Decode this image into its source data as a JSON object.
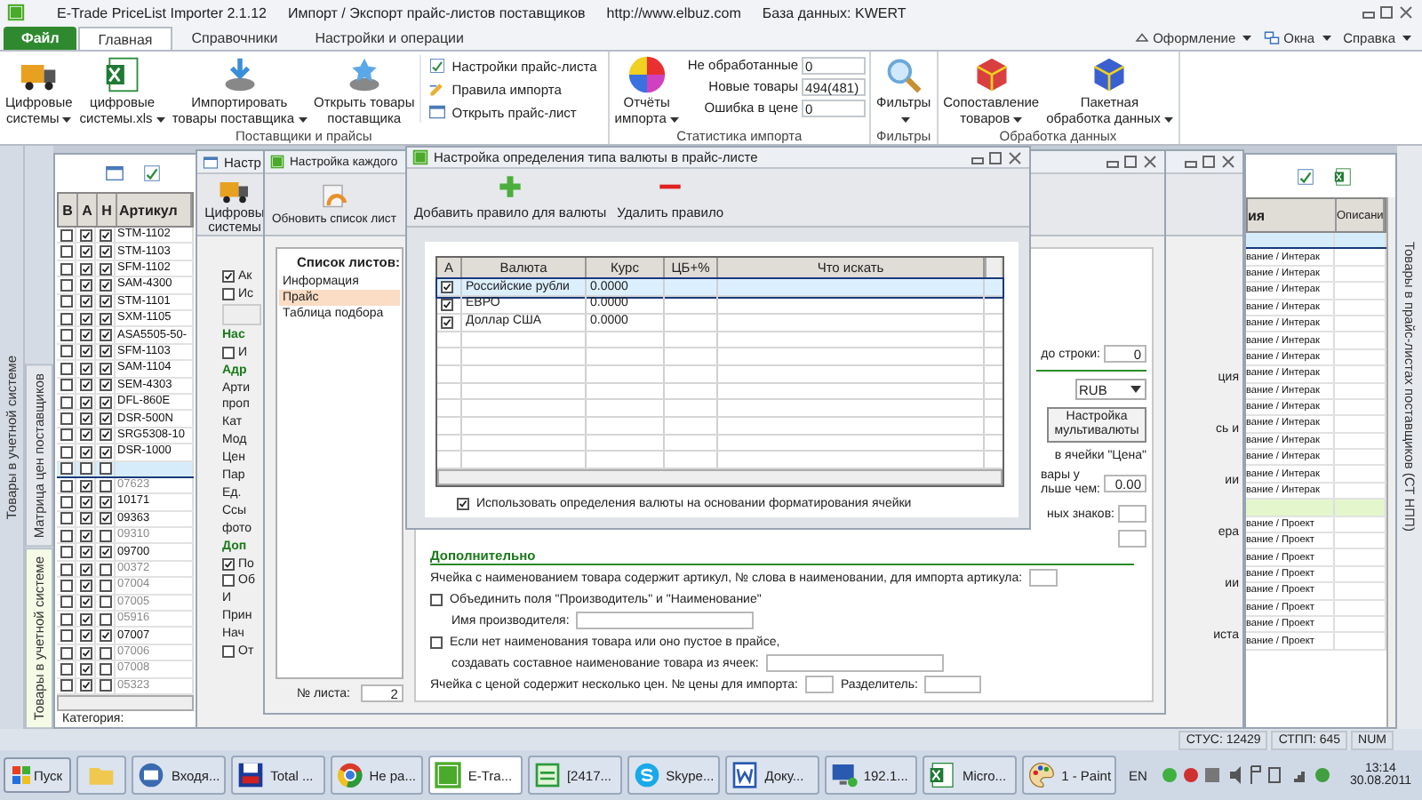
{
  "title_bar": {
    "title": "E-Trade PriceList Importer 2.1.12",
    "subtitle": "Импорт / Экспорт прайс-листов поставщиков",
    "url": "http://www.elbuz.com",
    "database": "База данных: KWERT"
  },
  "ribbon": {
    "file_tab": "Файл",
    "tabs": [
      {
        "label": "Главная",
        "selected": true
      },
      {
        "label": "Справочники",
        "selected": false
      },
      {
        "label": "Настройки и операции",
        "selected": false
      }
    ],
    "menus": [
      {
        "label": "Оформление"
      },
      {
        "label": "Окна"
      },
      {
        "label": "Справка"
      }
    ],
    "groups": [
      {
        "label": "Поставщики и прайсы",
        "items": [
          {
            "kind": "large",
            "lines": [
              "Цифровые",
              "системы"
            ],
            "dropdown": true
          },
          {
            "kind": "large",
            "lines": [
              "цифровые",
              "системы.xls"
            ],
            "dropdown": true
          },
          {
            "kind": "large",
            "lines": [
              "Импортировать",
              "товары поставщика"
            ],
            "dropdown": true
          },
          {
            "kind": "large",
            "lines": [
              "Открыть товары",
              "поставщика"
            ],
            "dropdown": false
          },
          {
            "kind": "list",
            "entries": [
              {
                "label": "Настройки прайс-листа"
              },
              {
                "label": "Правила импорта"
              },
              {
                "label": "Открыть прайс-лист"
              }
            ]
          }
        ]
      },
      {
        "label": "Статистика импорта",
        "items": [
          {
            "kind": "large",
            "lines": [
              "Отчёты",
              "импорта"
            ],
            "dropdown": true
          },
          {
            "kind": "stats",
            "entries": [
              {
                "label": "Не обработанные",
                "value": "0"
              },
              {
                "label": "Новые товары",
                "value": "494(481)"
              },
              {
                "label": "Ошибка в цене",
                "value": "0"
              }
            ]
          }
        ]
      },
      {
        "label": "Фильтры",
        "items": [
          {
            "kind": "large",
            "lines": [
              "Фильтры"
            ],
            "dropdown": true
          }
        ]
      },
      {
        "label": "Обработка данных",
        "items": [
          {
            "kind": "large",
            "lines": [
              "Сопоставление",
              "товаров"
            ],
            "dropdown": true
          },
          {
            "kind": "large",
            "lines": [
              "Пакетная",
              "обработка данных"
            ],
            "dropdown": true
          }
        ]
      }
    ]
  },
  "left_tabs": [
    {
      "label": "Товары в учетной системе",
      "selected": false
    }
  ],
  "inner_tabs": [
    {
      "label": "Матрица цен поставщиков",
      "selected": false
    },
    {
      "label": "Товары в учетной системе",
      "selected": true
    }
  ],
  "right_tab": {
    "label": "Товары в прайс-листах поставщиков (СТ НПП)"
  },
  "products_grid": {
    "columns": [
      "В",
      "А",
      "Н",
      "Артикул"
    ],
    "footer": "Категория:",
    "rows": [
      {
        "b": false,
        "a": true,
        "n": true,
        "article": "STM-1102",
        "selected": false
      },
      {
        "b": false,
        "a": true,
        "n": true,
        "article": "STM-1103",
        "selected": false
      },
      {
        "b": false,
        "a": true,
        "n": true,
        "article": "SFM-1102",
        "selected": false
      },
      {
        "b": false,
        "a": true,
        "n": true,
        "article": "SAM-4300",
        "selected": false
      },
      {
        "b": false,
        "a": true,
        "n": true,
        "article": "STM-1101",
        "selected": false
      },
      {
        "b": false,
        "a": true,
        "n": true,
        "article": "SXM-1105",
        "selected": false
      },
      {
        "b": false,
        "a": true,
        "n": true,
        "article": "ASA5505-50-",
        "selected": false
      },
      {
        "b": false,
        "a": true,
        "n": true,
        "article": "SFM-1103",
        "selected": false
      },
      {
        "b": false,
        "a": true,
        "n": true,
        "article": "SAM-1104",
        "selected": false
      },
      {
        "b": false,
        "a": true,
        "n": true,
        "article": "SEM-4303",
        "selected": false
      },
      {
        "b": false,
        "a": true,
        "n": true,
        "article": "DFL-860E",
        "selected": false
      },
      {
        "b": false,
        "a": true,
        "n": true,
        "article": "DSR-500N",
        "selected": false
      },
      {
        "b": false,
        "a": true,
        "n": true,
        "article": "SRG5308-10",
        "selected": false
      },
      {
        "b": false,
        "a": true,
        "n": true,
        "article": "DSR-1000",
        "selected": false
      },
      {
        "b": false,
        "a": false,
        "n": false,
        "selected": true
      },
      {
        "b": false,
        "a": true,
        "n": false,
        "article": "07623",
        "selected": false
      },
      {
        "b": false,
        "a": true,
        "n": true,
        "article": "10171",
        "selected": false
      },
      {
        "b": false,
        "a": true,
        "n": true,
        "article": "09363",
        "selected": false
      },
      {
        "b": false,
        "a": true,
        "n": false,
        "article": "09310",
        "selected": false
      },
      {
        "b": false,
        "a": true,
        "n": true,
        "article": "09700",
        "selected": false
      },
      {
        "b": false,
        "a": true,
        "n": false,
        "article": "00372",
        "selected": false
      },
      {
        "b": false,
        "a": true,
        "n": false,
        "article": "07004",
        "selected": false
      },
      {
        "b": false,
        "a": true,
        "n": false,
        "article": "07005",
        "selected": false
      },
      {
        "b": false,
        "a": true,
        "n": false,
        "article": "05916",
        "selected": false
      },
      {
        "b": false,
        "a": true,
        "n": true,
        "article": "07007",
        "selected": false
      },
      {
        "b": false,
        "a": true,
        "n": false,
        "article": "07006",
        "selected": false
      },
      {
        "b": false,
        "a": true,
        "n": false,
        "article": "07008",
        "selected": false
      },
      {
        "b": false,
        "a": true,
        "n": false,
        "article": "05323",
        "selected": false
      }
    ]
  },
  "price_grid": {
    "columns": [
      "ия",
      "Описани"
    ],
    "rows": [
      {
        "kind": "blank",
        "selected": true
      },
      {
        "kind": "item",
        "text": "вание / Интерак",
        "selected": false
      },
      {
        "kind": "item",
        "text": "вание / Интерак",
        "selected": false
      },
      {
        "kind": "item",
        "text": "вание / Интерак",
        "selected": false
      },
      {
        "kind": "item",
        "text": "вание / Интерак",
        "selected": false
      },
      {
        "kind": "item",
        "text": "вание / Интерак",
        "selected": false
      },
      {
        "kind": "item",
        "text": "вание / Интерак",
        "selected": false
      },
      {
        "kind": "item",
        "text": "вание / Интерак",
        "selected": false
      },
      {
        "kind": "item",
        "text": "вание / Интерак",
        "selected": false
      },
      {
        "kind": "item",
        "text": "вание / Интерак",
        "selected": false
      },
      {
        "kind": "item",
        "text": "вание / Интерак",
        "selected": false
      },
      {
        "kind": "item",
        "text": "вание / Интерак",
        "selected": false
      },
      {
        "kind": "item",
        "text": "вание / Интерак",
        "selected": false
      },
      {
        "kind": "item",
        "text": "вание / Интерак",
        "selected": false
      },
      {
        "kind": "item",
        "text": "вание / Интерак",
        "selected": false
      },
      {
        "kind": "item",
        "text": "вание / Интерак",
        "selected": false
      },
      {
        "kind": "group",
        "selected": false
      },
      {
        "kind": "item",
        "text": "вание / Проект",
        "selected": false
      },
      {
        "kind": "item",
        "text": "вание / Проект",
        "selected": false
      },
      {
        "kind": "item",
        "text": "вание / Проект",
        "selected": false
      },
      {
        "kind": "item",
        "text": "вание / Проект",
        "selected": false
      },
      {
        "kind": "item",
        "text": "вание / Проект",
        "selected": false
      },
      {
        "kind": "item",
        "text": "вание / Проект",
        "selected": false
      },
      {
        "kind": "item",
        "text": "вание / Проект",
        "selected": false
      },
      {
        "kind": "item",
        "text": "вание / Проект",
        "selected": false
      }
    ]
  },
  "supplier_window": {
    "title": "Настр",
    "tool": "Цифровы системы",
    "fragments": [
      {
        "kind": "checkbox",
        "label": "Ак",
        "checked": true
      },
      {
        "kind": "checkbox",
        "label": "Ис",
        "checked": false
      },
      {
        "kind": "field"
      },
      {
        "kind": "heading",
        "label": "Нас"
      },
      {
        "kind": "checkbox",
        "label": "И",
        "checked": false
      },
      {
        "kind": "heading",
        "label": "Адр"
      },
      {
        "kind": "label",
        "label": "Арти"
      },
      {
        "kind": "label",
        "label": "проп"
      },
      {
        "kind": "label",
        "label": "Кат"
      },
      {
        "kind": "label",
        "label": "Мод"
      },
      {
        "kind": "label",
        "label": "Цен"
      },
      {
        "kind": "label",
        "label": "Пар"
      },
      {
        "kind": "label",
        "label": "Ед."
      },
      {
        "kind": "label",
        "label": "Ссы"
      },
      {
        "kind": "label",
        "label": "фото"
      },
      {
        "kind": "heading",
        "label": "Доп"
      },
      {
        "kind": "checkbox",
        "label": "По",
        "checked": true
      },
      {
        "kind": "checkbox",
        "label": "Об",
        "checked": false
      },
      {
        "kind": "label",
        "label": "И"
      },
      {
        "kind": "label",
        "label": "Прин"
      },
      {
        "kind": "label",
        "label": "Нач"
      },
      {
        "kind": "checkbox",
        "label": "От",
        "checked": false
      }
    ],
    "side_fragments": [
      "ция",
      "сь и",
      "ии",
      "ера",
      "ии",
      "иста"
    ]
  },
  "sheet_window": {
    "title": "Настройка каждого",
    "tool": "Обновить список лист",
    "list_label": "Список листов:",
    "sheets": [
      {
        "label": "Информация",
        "selected": false
      },
      {
        "label": "Прайс",
        "selected": true
      },
      {
        "label": "Таблица подбора",
        "selected": false
      }
    ],
    "sheet_number_label": "№ листа:",
    "sheet_number": "2",
    "to_row_label": "до строки:",
    "to_row": "0",
    "currency": "RUB",
    "multi_button": "Настройка мультивалюты",
    "price_cell": "в ячейки \"Цена\"",
    "more_lines": [
      "вары у",
      "льше чем:"
    ],
    "more_value": "0.00",
    "digits_label": "ных знаков:",
    "extra_heading": "Дополнительно",
    "extra_rows": [
      {
        "kind": "field",
        "label": "Ячейка с наименованием товара содержит артикул, № слова в наименовании, для импорта артикула:"
      },
      {
        "kind": "checkbox",
        "label": "Объединить поля \"Производитель\" и \"Наименование\"",
        "checked": false
      },
      {
        "kind": "wide-field",
        "label": "Имя производителя:"
      },
      {
        "kind": "checkbox",
        "label": "Если нет наименования товара или оно пустое в прайсе,",
        "checked": false
      },
      {
        "kind": "wide-field",
        "label": "создавать составное наименование товара из ячеек:"
      },
      {
        "kind": "pair",
        "label": "Ячейка с ценой содержит несколько цен. № цены для импорта:",
        "label2": "Разделитель:"
      }
    ]
  },
  "currency_window": {
    "title": "Настройка определения типа валюты в прайс-листе",
    "tools": [
      {
        "label": "Добавить правило для валюты"
      },
      {
        "label": "Удалить правило"
      }
    ],
    "columns": [
      "А",
      "Валюта",
      "Курс",
      "ЦБ+%",
      "Что искать"
    ],
    "rows": [
      {
        "active": true,
        "currency": "Российские рубли",
        "rate": "0.0000",
        "selected": true
      },
      {
        "active": true,
        "currency": "ЕВРО",
        "rate": "0.0000",
        "selected": false
      },
      {
        "active": true,
        "currency": "Доллар США",
        "rate": "0.0000",
        "selected": false
      }
    ],
    "option": {
      "label": "Использовать определения валюты на основании форматирования ячейки",
      "checked": true
    }
  },
  "status_bar": [
    "СТУС: 12429",
    "СТПП: 645",
    "NUM"
  ],
  "taskbar": {
    "start": "Пуск",
    "tasks": [
      {
        "selected": false
      },
      {
        "label": "Входя...",
        "selected": false
      },
      {
        "label": "Total ...",
        "selected": false
      },
      {
        "label": "Не ра...",
        "selected": false
      },
      {
        "label": "E-Tra...",
        "selected": true
      },
      {
        "label": "[2417...",
        "selected": false
      },
      {
        "label": "Skype...",
        "selected": false
      },
      {
        "label": "Доку...",
        "selected": false
      },
      {
        "label": "192.1...",
        "selected": false
      },
      {
        "label": "Micro...",
        "selected": false
      },
      {
        "label": "1 - Paint",
        "selected": false
      }
    ],
    "language": "EN",
    "time": "13:14",
    "date": "30.08.2011"
  }
}
